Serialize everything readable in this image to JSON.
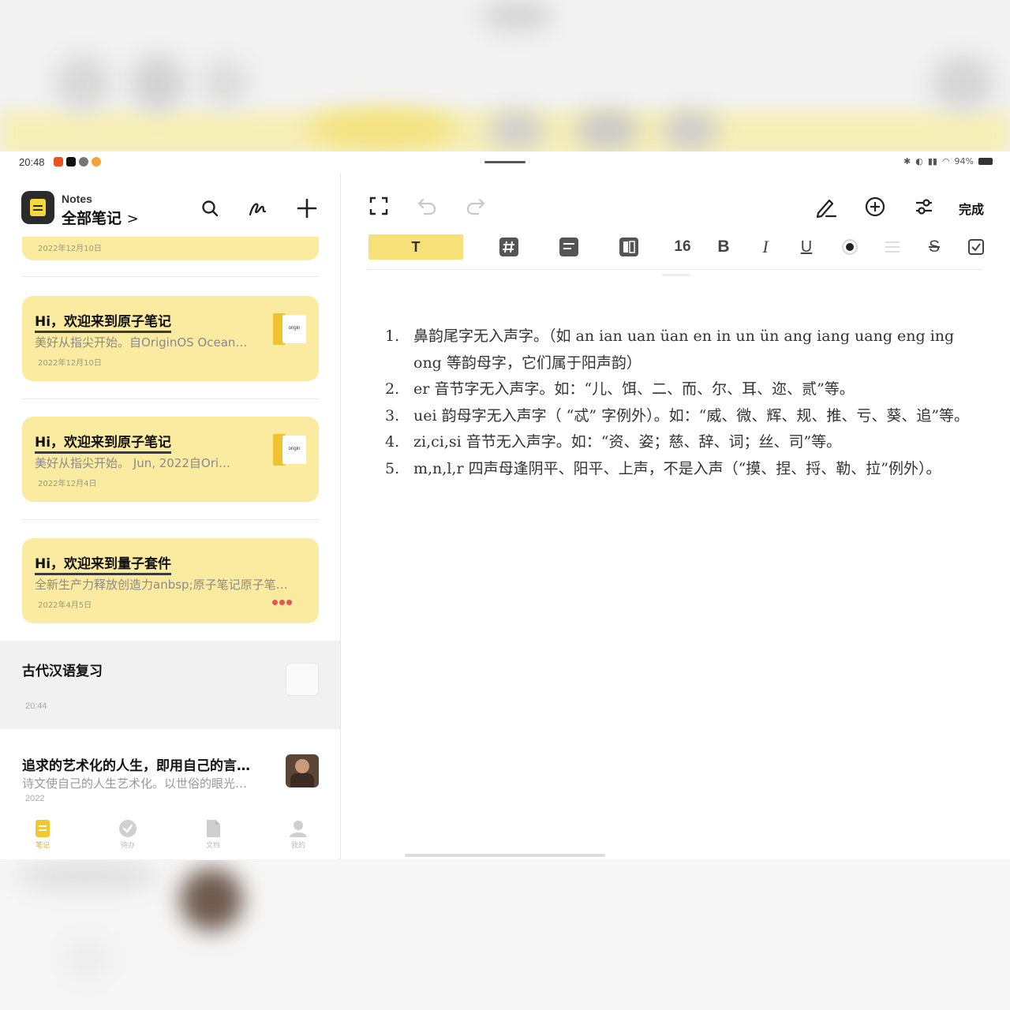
{
  "status": {
    "time": "20:48",
    "battery": "94%",
    "app_icon_colors": [
      "#e8541f",
      "#111111",
      "#555555",
      "#f2a33a"
    ]
  },
  "sidebar": {
    "app_name": "Notes",
    "folder": "全部笔记",
    "folder_chevron": ">",
    "cards": [
      {
        "date": "2022年12月10日"
      },
      {
        "title": "Hi，欢迎来到原子笔记",
        "desc": "美好从指尖开始。自OriginOS Ocean…",
        "date": "2022年12月10日",
        "thumb_text": "origin"
      },
      {
        "title": "Hi，欢迎来到原子笔记",
        "desc": "美好从指尖开始。    Jun, 2022自Ori…",
        "date": "2022年12月4日",
        "thumb_text": "origin"
      },
      {
        "title": "Hi，欢迎来到量子套件",
        "desc": "全新生产力释放创造力anbsp;原子笔记原子笔…",
        "date": "2022年4月5日"
      }
    ],
    "items": [
      {
        "title": "古代汉语复习",
        "time": "20:44"
      },
      {
        "title": "追求的艺术化的人生，即用自己的言…",
        "desc": "诗文使自己的人生艺术化。以世俗的眼光…",
        "time": "2022"
      }
    ],
    "tabs": [
      {
        "label": "笔记"
      },
      {
        "label": "待办"
      },
      {
        "label": "文档"
      },
      {
        "label": "我的"
      }
    ]
  },
  "editor": {
    "done_label": "完成",
    "format": {
      "text_style": "T",
      "font_size": "16",
      "bold": "B",
      "italic": "I",
      "underline": "U",
      "strike": "S"
    },
    "list": [
      {
        "num": "1.",
        "text": "鼻韵尾字无入声字。（如 an ian uan üan en in un ün ang iang uang eng ing ong 等韵母字，它们属于阳声韵）"
      },
      {
        "num": "2.",
        "text": "er 音节字无入声字。如：“儿、饵、二、而、尔、耳、迩、贰”等。"
      },
      {
        "num": "3.",
        "text": "uei 韵母字无入声字（ “忒” 字例外）。如：“威、微、辉、规、推、亏、葵、追”等。"
      },
      {
        "num": "4.",
        "text": "zi,ci,si 音节无入声字。如：“资、姿；慈、辞、词；丝、司”等。"
      },
      {
        "num": "5.",
        "text": "m,n,l,r 四声母逢阴平、阳平、上声，不是入声（“摸、捏、捋、勒、拉”例外）。"
      }
    ]
  }
}
